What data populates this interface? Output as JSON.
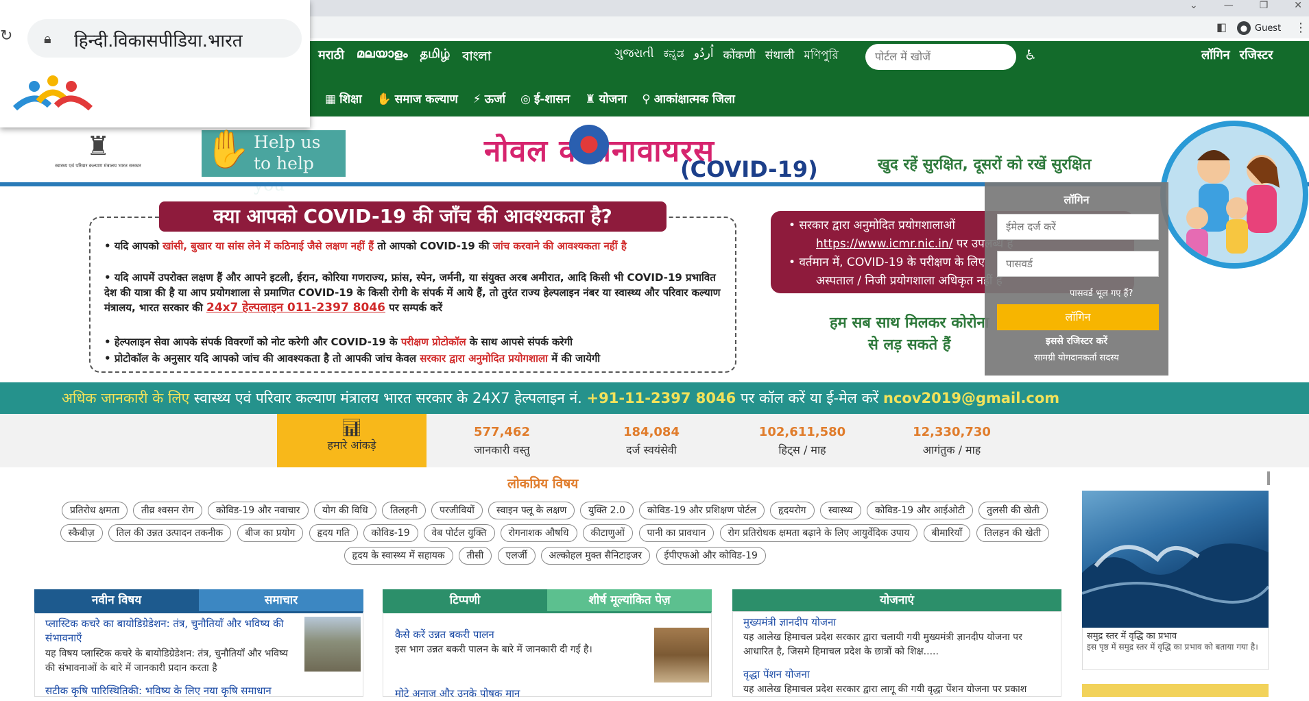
{
  "browser": {
    "url": "हिन्दी.विकासपीडिया.भारत",
    "profile": "Guest"
  },
  "topnav": {
    "languages_left": [
      "मराठी",
      "മലയാളം",
      "தமிழ்",
      "বাংলা"
    ],
    "languages_right": [
      "ગુજરાતી",
      "ಕನ್ನಡ",
      "اُردُو",
      "कोंकणी",
      "संथाली",
      "মণিপুরি"
    ],
    "search_placeholder": "पोर्टल में खोजें",
    "login": "लॉगिन",
    "register": "रजिस्टर"
  },
  "menu": [
    "शिक्षा",
    "समाज कल्याण",
    "ऊर्जा",
    "ई-शासन",
    "योजना",
    "आकांक्षात्मक जिला"
  ],
  "banner": {
    "emblem_caption": "स्वास्थ्य एवं परिवार कल्याण मंत्रालय भारत सरकार",
    "help_text": "Help us to help you",
    "title": "नोवल  कोरोनावायरस",
    "subtitle": "(COVID-19)",
    "tagline": "खुद रहें सुरक्षित, दूसरों को रखें सुरक्षित"
  },
  "covid_box": {
    "heading": "क्या आपको COVID-19 की जाँच की आवश्यकता है?",
    "items": [
      {
        "a": "यदि आपको ",
        "r": "खांसी, बुखार या सांस लेने में कठिनाई जैसे लक्षण नहीं हैं",
        "b": " तो आपको COVID-19 की ",
        "r2": "जांच करवाने की आवश्यकता नहीं है"
      },
      {
        "text": "यदि आपमें उपरोक्त लक्षण हैं और आपने इटली, ईरान, कोरिया गणराज्य, फ्रांस, स्पेन, जर्मनी, या संयुक्त अरब अमीरात, आदि किसी भी COVID-19 प्रभावित देश की यात्रा की है या आप प्रयोगशाला से प्रमाणित COVID-19 के किसी रोगी के संपर्क में आये हैं, तो तुरंत राज्य हेल्पलाइन नंबर या स्वास्थ्य और परिवार कल्याण मंत्रालय, भारत सरकार की ",
        "helpline": "24x7 हेल्पलाइन 011-2397 8046",
        "tail": " पर सम्पर्क करें"
      },
      {
        "a": "हेल्पलाइन सेवा आपके संपर्क विवरणों को नोट करेगी और COVID-19 के ",
        "r": "परीक्षण प्रोटोकॉल",
        "b": " के साथ आपसे संपर्क करेगी"
      },
      {
        "a": "प्रोटोकॉल के अनुसार यदि आपको जांच की आवश्यकता है तो आपकी जांच केवल ",
        "r": "सरकार द्वारा अनुमोदित प्रयोगशाला",
        "b": " में की जायेगी"
      }
    ]
  },
  "lab_box": {
    "line1": "सरकार द्वारा अनुमोदित प्रयोगशालाओं",
    "link": "https://www.icmr.nic.in/",
    "line1b": "पर उपलब्ध है",
    "line2": "वर्तमान में, COVID-19 के परीक्षण के लिए",
    "line3": "अस्पताल / निजी प्रयोगशाला अधिकृत नहीं है",
    "together1": "हम सब साथ मिलकर कोरोना",
    "together2": "से लड़ सकते हैं"
  },
  "login_panel": {
    "title": "लॉगिन",
    "email_placeholder": "ईमेल दर्ज करें",
    "password_placeholder": "पासवर्ड",
    "forgot": "पासवर्ड भूल गए हैं?",
    "button": "लॉगिन",
    "register": "इससे रजिस्टर करें",
    "register_sub": "सामग्री योगदानकर्ता   सदस्य"
  },
  "helpline_strip": {
    "pre": "अधिक जानकारी के लिए",
    "mid": " स्वास्थ्य एवं परिवार कल्याण मंत्रालय भारत सरकार के 24X7 हेल्पलाइन नं. ",
    "phone": "+91-11-2397 8046",
    "mid2": " पर कॉल करें या ई-मेल करें ",
    "email": "ncov2019@gmail.com"
  },
  "stats": {
    "our_label": "हमारे आंकड़े",
    "items": [
      {
        "num": "577,462",
        "label": "जानकारी वस्तु"
      },
      {
        "num": "184,084",
        "label": "दर्ज स्वयंसेवी"
      },
      {
        "num": "102,611,580",
        "label": "हिट्स / माह"
      },
      {
        "num": "12,330,730",
        "label": "आगंतुक / माह"
      }
    ]
  },
  "popular": {
    "title": "लोकप्रिय विषय",
    "tags": [
      "प्रतिरोध क्षमता",
      "तीव्र श्वसन रोग",
      "कोविड-19 और नवाचार",
      "योग की विधि",
      "तिलहनी",
      "परजीवियों",
      "स्वाइन फ्लू के लक्षण",
      "युक्ति 2.0",
      "कोविड-19 और प्रशिक्षण पोर्टल",
      "हृदयरोग",
      "स्वास्थ्य",
      "कोविड-19 और आईओटी",
      "तुलसी की खेती",
      "स्कैबीज़",
      "तिल की उन्नत उत्पादन तकनीक",
      "बीज का प्रयोग",
      "हृदय गति",
      "कोविड-19",
      "वेब पोर्टल युक्ति",
      "रोगनाशक औषधि",
      "कीटाणुओं",
      "पानी का प्रावधान",
      "रोग प्रतिरोधक क्षमता बढ़ाने के लिए आयुर्वेदिक उपाय",
      "बीमारियाँ",
      "तिलहन की खेती",
      "हृदय के स्वास्थ्य में सहायक",
      "तीसी",
      "एलर्जी",
      "अल्कोहल मुक्त सैनिटाइजर",
      "ईपीएफओ और कोविड-19"
    ]
  },
  "box1": {
    "tab1": "नवीन विषय",
    "tab2": "समाचार",
    "item1_title": "प्लास्टिक कचरे का बायोडिग्रेडेशन: तंत्र, चुनौतियाँ और भविष्य की संभावनाएँ",
    "item1_text": "यह विषय प्लास्टिक कचरे के बायोडिग्रेडेशन: तंत्र, चुनौतियाँ और भविष्य की संभावनाओं के बारे में जानकारी प्रदान करता है",
    "item2_title": "सटीक कृषि पारिस्थितिकी: भविष्य के लिए नया कृषि समाधान"
  },
  "box2": {
    "tab1": "टिप्पणी",
    "tab2": "शीर्ष मूल्यांकित पेज़",
    "item1_title": "कैसे करें उन्नत बकरी पालन",
    "item1_text": "इस भाग उन्नत बकरी पालन के बारे में जानकारी दी गई है।",
    "item2_title": "मोटे अनाज और उनके पोषक मान"
  },
  "box3": {
    "tab1": "योजनाएं",
    "item1_title": "मुख्यमंत्री ज्ञानदीप योजना",
    "item1_text": "यह आलेख हिमाचल प्रदेश सरकार द्वारा चलायी गयी मुख्यमंत्री ज्ञानदीप योजना पर आधारित है, जिसमे हिमाचल प्रदेश के छात्रों को शिक्ष.....",
    "item2_title": "वृद्धा पेंशन योजना",
    "item2_text": "यह आलेख हिमाचल प्रदेश सरकार द्वारा लागू की गयी वृद्धा पेंशन योजना पर प्रकाश"
  },
  "side": {
    "caption_title": "समुद्र स्तर में वृद्धि का प्रभाव",
    "caption_text": "इस पृष्ठ में समुद्र स्तर में वृद्धि का प्रभाव को बताया गया है।"
  }
}
